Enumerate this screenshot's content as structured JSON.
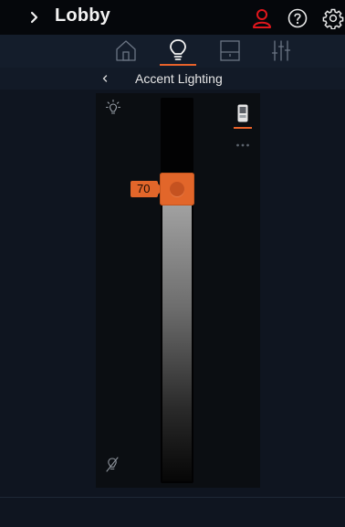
{
  "header": {
    "expand_icon": "chevron-right-icon",
    "room_title": "Lobby",
    "user_icon": "user-icon",
    "help_icon": "help-icon",
    "settings_icon": "gear-icon",
    "user_icon_color": "#e0161c"
  },
  "tabs": [
    {
      "icon": "home-icon",
      "active": false
    },
    {
      "icon": "lightbulb-icon",
      "active": true
    },
    {
      "icon": "shade-icon",
      "active": false
    },
    {
      "icon": "equalizer-icon",
      "active": false
    }
  ],
  "breadcrumb": {
    "back_icon": "chevron-left-icon",
    "title": "Accent Lighting"
  },
  "dimmer": {
    "level": 70,
    "level_label": "70",
    "max_icon": "light-on-icon",
    "min_icon": "light-off-icon",
    "device_icon": "keypad-icon",
    "more_icon": "more-icon"
  },
  "colors": {
    "accent": "#e2662a",
    "background": "#0f1520",
    "panel": "#0b0e12",
    "header": "#05070b"
  }
}
